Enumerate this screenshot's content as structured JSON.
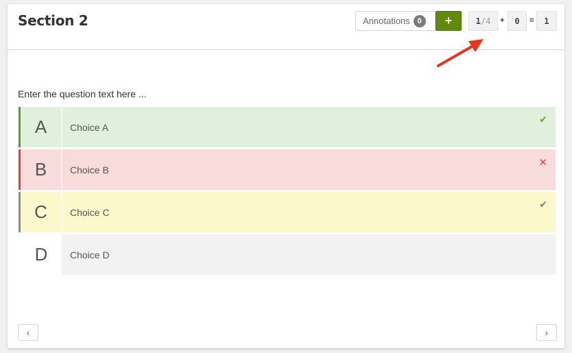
{
  "header": {
    "title": "Section 2",
    "annotations_label": "Annotations",
    "annotations_count": "0",
    "add_label": "+",
    "score": {
      "points": "1",
      "separator": "/",
      "total": "4",
      "plus": "+",
      "bonus": "0",
      "equals": "=",
      "result": "1"
    }
  },
  "question": {
    "text": "Enter the question text here ..."
  },
  "choices": [
    {
      "letter": "A",
      "label": "Choice A",
      "state": "correct",
      "mark": "✔"
    },
    {
      "letter": "B",
      "label": "Choice B",
      "state": "wrong",
      "mark": "✕"
    },
    {
      "letter": "C",
      "label": "Choice C",
      "state": "missed",
      "mark": "✔"
    },
    {
      "letter": "D",
      "label": "Choice D",
      "state": "neutral",
      "mark": ""
    }
  ],
  "nav": {
    "prev_icon": "chevron-left-icon",
    "next_icon": "chevron-right-icon",
    "prev_glyph": "‹",
    "next_glyph": "›"
  },
  "colors": {
    "add_button": "#5f8a0c",
    "correct_bg": "#e1f0dc",
    "correct_accent": "#5c9a2e",
    "wrong_bg": "#f8dcdb",
    "wrong_accent": "#d5453e",
    "missed_bg": "#fbf9cc",
    "arrow": "#e8341c"
  }
}
